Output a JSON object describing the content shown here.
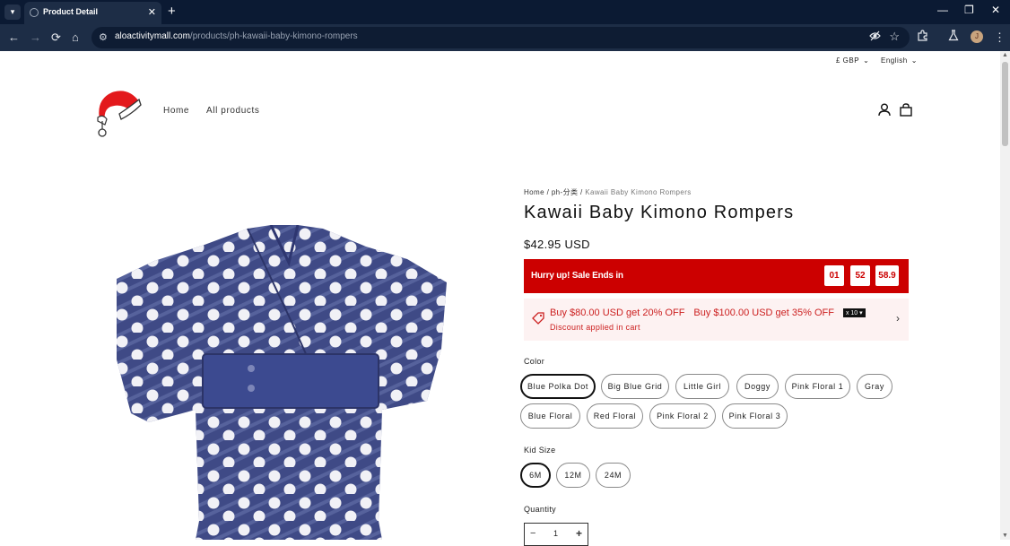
{
  "browser": {
    "tab_title": "Product Detail",
    "tab_close": "✕",
    "new_tab": "+",
    "minimize": "—",
    "restore": "❐",
    "close": "✕",
    "back": "←",
    "forward": "→",
    "reload": "⟳",
    "home": "⌂",
    "site_info": "⚙",
    "url_host": "aloactivitymall.com",
    "url_path": "/products/ph-kawaii-baby-kimono-rompers",
    "profile_initial": "J",
    "menu": "⋮"
  },
  "header": {
    "currency": "£ GBP",
    "language": "English",
    "nav": [
      "Home",
      "All products"
    ]
  },
  "breadcrumb": {
    "home": "Home",
    "sep1": " / ",
    "category": "ph-分类",
    "sep2": " / ",
    "current": "Kawaii Baby Kimono Rompers"
  },
  "product": {
    "title": "Kawaii Baby Kimono Rompers",
    "price": "$42.95 USD"
  },
  "sale": {
    "text": "Hurry up! Sale Ends in",
    "hours": "01",
    "minutes": "52",
    "seconds": "58.9",
    "color": "#cc0000"
  },
  "discount": {
    "offer1": "Buy $80.00 USD get 20% OFF",
    "offer2": "Buy $100.00 USD get 35% OFF",
    "multiplier": "x 10 ▾",
    "note": "Discount applied in cart"
  },
  "color_option": {
    "label": "Color",
    "selected": "Blue Polka Dot",
    "values": [
      "Blue Polka Dot",
      "Big Blue Grid",
      "Little Girl",
      "Doggy",
      "Pink Floral 1",
      "Gray",
      "Blue Floral",
      "Red Floral",
      "Pink Floral 2",
      "Pink Floral 3"
    ]
  },
  "size_option": {
    "label": "Kid Size",
    "selected": "6M",
    "values": [
      "6M",
      "12M",
      "24M"
    ]
  },
  "quantity": {
    "label": "Quantity",
    "value": "1",
    "minus": "−",
    "plus": "+"
  }
}
